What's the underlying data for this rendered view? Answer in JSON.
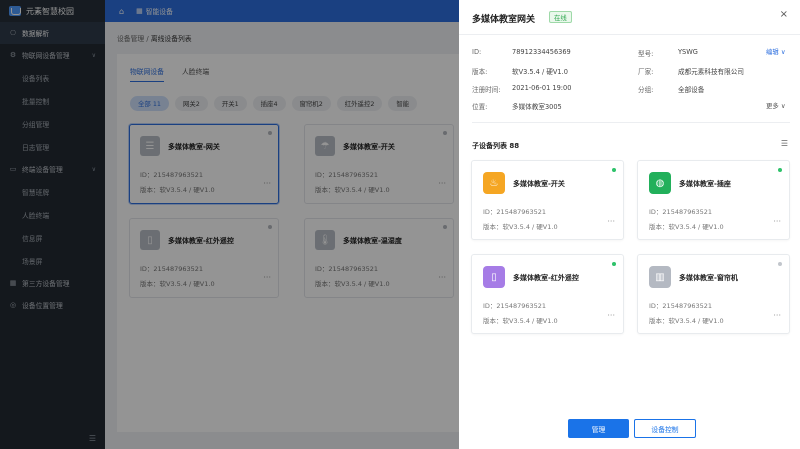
{
  "app": {
    "logo_text": "元素智慧校园"
  },
  "topbar": {
    "home_icon": "⌂",
    "tab_label": "智能设备"
  },
  "sidebar": {
    "items": [
      {
        "label": "数据解析",
        "icon": "⎔",
        "active": true
      },
      {
        "label": "物联网设备管理",
        "icon": "⚙",
        "expandable": true
      },
      {
        "label": "设备列表",
        "sub": true
      },
      {
        "label": "批量控制",
        "sub": true
      },
      {
        "label": "分组管理",
        "sub": true
      },
      {
        "label": "日志管理",
        "sub": true
      },
      {
        "label": "终端设备管理",
        "icon": "▭",
        "expandable": true
      },
      {
        "label": "智慧班牌",
        "sub": true
      },
      {
        "label": "人脸终端",
        "sub": true
      },
      {
        "label": "信息屏",
        "sub": true
      },
      {
        "label": "场景屏",
        "sub": true
      },
      {
        "label": "第三方设备管理",
        "icon": "▦"
      },
      {
        "label": "设备位置管理",
        "icon": "◎"
      }
    ]
  },
  "breadcrumb": {
    "parent": "设备管理",
    "sep": " / ",
    "current": "离线设备列表"
  },
  "main": {
    "tabs": [
      {
        "label": "物联网设备",
        "on": true
      },
      {
        "label": "人脸终端",
        "on": false
      }
    ],
    "chips": [
      {
        "label": "全部 11",
        "on": true
      },
      {
        "label": "网关2"
      },
      {
        "label": "开关1"
      },
      {
        "label": "插座4"
      },
      {
        "label": "窗帘机2"
      },
      {
        "label": "红外遥控2"
      },
      {
        "label": "智能"
      }
    ],
    "cards": [
      {
        "title": "多媒体教室-网关",
        "id": "ID：215487963521",
        "version": "版本：软V3.5.4 / 硬V1.0",
        "icon": "☰",
        "selected": true
      },
      {
        "title": "多媒体教室-开关",
        "id": "ID：215487963521",
        "version": "版本：软V3.5.4 / 硬V1.0",
        "icon": "☂",
        "selected": false
      },
      {
        "title": "多媒体教室-红外遥控",
        "id": "ID：215487963521",
        "version": "版本：软V3.5.4 / 硬V1.0",
        "icon": "▯",
        "selected": false
      },
      {
        "title": "多媒体教室-温湿度",
        "id": "ID：215487963521",
        "version": "版本：软V3.5.4 / 硬V1.0",
        "icon": "🌡",
        "selected": false
      }
    ]
  },
  "drawer": {
    "title": "多媒体教室网关",
    "status": "在线",
    "close": "×",
    "info": {
      "id_label": "ID:",
      "id": "78912334456369",
      "version_label": "版本:",
      "version": "软V3.5.4 / 硬V1.0",
      "reg_label": "注册时间:",
      "reg": "2021-06-01 19:00",
      "loc_label": "位置:",
      "loc": "多媒体教室3005",
      "model_label": "型号:",
      "model": "YSWG",
      "vendor_label": "厂家:",
      "vendor": "成都元素科技有限公司",
      "group_label": "分组:",
      "group": "全部设备",
      "edit": "编辑 ∨",
      "more": "更多 ∨"
    },
    "sub_title": "子设备列表 88",
    "list_icon": "☰",
    "sub_cards": [
      {
        "title": "多媒体教室-开关",
        "id": "ID：215487963521",
        "version": "版本：软V3.5.4 / 硬V1.0",
        "icon": "♨",
        "color": "#f5a623",
        "dot": "#2ec26a"
      },
      {
        "title": "多媒体教室-插座",
        "id": "ID：215487963521",
        "version": "版本：软V3.5.4 / 硬V1.0",
        "icon": "◍",
        "color": "#22b05b",
        "dot": "#2ec26a"
      },
      {
        "title": "多媒体教室-红外遥控",
        "id": "ID：215487963521",
        "version": "版本：软V3.5.4 / 硬V1.0",
        "icon": "▯",
        "color": "#a67ce6",
        "dot": "#2ec26a"
      },
      {
        "title": "多媒体教室-窗帘机",
        "id": "ID：215487963521",
        "version": "版本：软V3.5.4 / 硬V1.0",
        "icon": "▥",
        "color": "#b4b9c2",
        "dot": "#c2c6cc"
      }
    ],
    "buttons": {
      "manage": "管理",
      "control": "设备控制"
    }
  }
}
